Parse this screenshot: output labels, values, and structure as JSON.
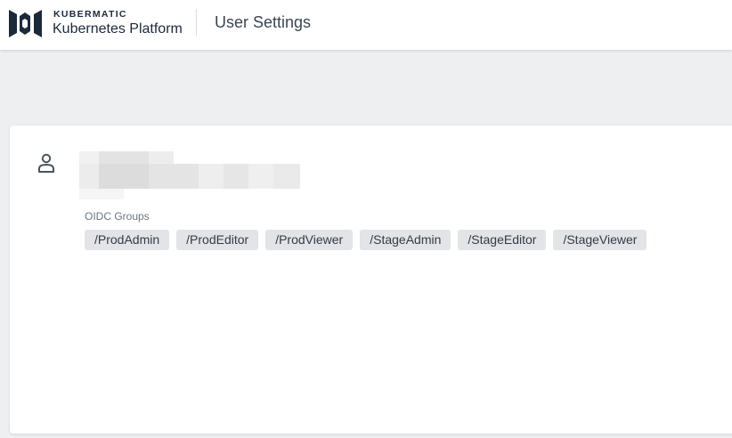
{
  "header": {
    "brand_name": "KUBERMATIC",
    "brand_product": "Kubernetes Platform",
    "page_title": "User Settings",
    "logo_icon": "kubermatic-logo-icon"
  },
  "profile": {
    "avatar_icon": "person-icon",
    "name_redacted": true,
    "oidc_groups_label": "OIDC Groups",
    "oidc_groups": [
      "/ProdAdmin",
      "/ProdEditor",
      "/ProdViewer",
      "/StageAdmin",
      "/StageEditor",
      "/StageViewer"
    ]
  },
  "colors": {
    "brand": "#1b2a3a",
    "page_background": "#eeeff1",
    "chip_background": "#e2e4e7"
  }
}
